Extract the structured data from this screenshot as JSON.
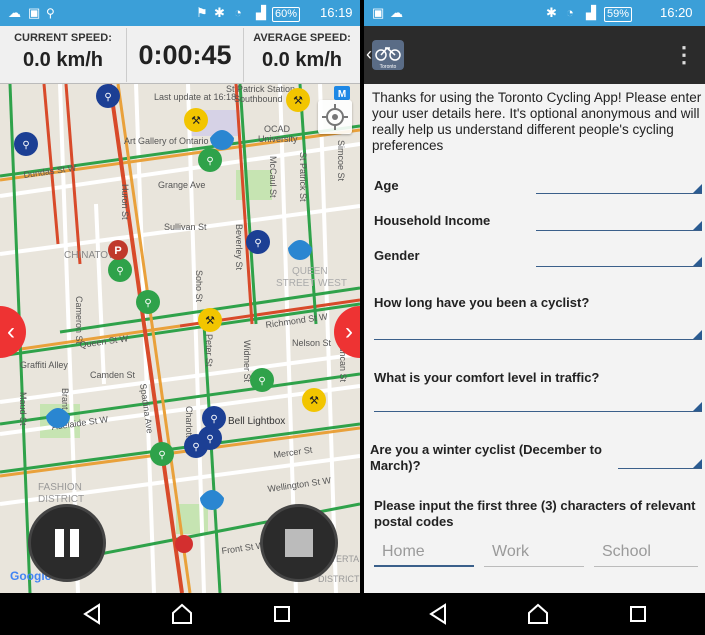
{
  "left_screen": {
    "status_bar": {
      "battery_text": "60%",
      "time": "16:19"
    },
    "speed_panel": {
      "current_speed_label": "CURRENT SPEED:",
      "current_speed_value": "0.0 km/h",
      "timer": "0:00:45",
      "average_speed_label": "AVERAGE SPEED:",
      "average_speed_value": "0.0 km/h"
    },
    "map": {
      "last_update": "Last update at 16:18",
      "labels": [
        "St Patrick Station -",
        "Southbound",
        "OCAD",
        "University",
        "Art Gallery of Ontario",
        "Dundas St W",
        "Huron St",
        "Grange Ave",
        "McCaul St",
        "St Patrick St",
        "Simcoe St",
        "Sullivan St",
        "Beverley St",
        "CHINATOWN",
        "Soho St",
        "QUEEN",
        "STREET WEST",
        "Cameron St",
        "Queen St W",
        "Richmond St W",
        "Graffiti Alley",
        "Peter St",
        "Widmer St",
        "Nelson St",
        "Duncan St",
        "Maud St",
        "Brant St",
        "Camden St",
        "Spadina Ave",
        "Charlotte St",
        "Bell Lightbox",
        "Adelaide St W",
        "Mercer St",
        "Wellington St W",
        "FASHION",
        "DISTRICT",
        "Front St W",
        "ENTERTAINMENT",
        "DISTRICT",
        "Google"
      ],
      "icons": [
        "bike-share-icon",
        "construction-icon",
        "water-drop-icon",
        "bike-parking-icon",
        "locate-icon"
      ]
    },
    "controls": {
      "pause_icon": "pause-icon",
      "stop_icon": "stop-icon",
      "left_arrow": "‹",
      "right_arrow": "›"
    }
  },
  "right_screen": {
    "status_bar": {
      "battery_text": "59%",
      "time": "16:20"
    },
    "app_bar": {
      "logo_text": "Toronto",
      "menu_icon": "⋮"
    },
    "intro_lines": [
      "Thanks for using the Toronto Cycling App! Please enter",
      "your user details here. It's optional anonymous and will",
      "really help us understand different people's cycling",
      "preferences"
    ],
    "questions": {
      "age": "Age",
      "income": "Household Income",
      "gender": "Gender",
      "how_long": "How long have you been a cyclist?",
      "comfort": "What is your comfort level in traffic?",
      "winter_line1": "Are you a winter cyclist (December to",
      "winter_line2": "March)?",
      "postal_line1": "Please input the first three (3) characters of relevant",
      "postal_line2": "postal codes"
    },
    "postal_inputs": {
      "home_placeholder": "Home",
      "work_placeholder": "Work",
      "school_placeholder": "School"
    }
  },
  "colors": {
    "status_bar": "#3b9fd8",
    "app_bar": "#2b2b2b",
    "dropdown_accent": "#2a5b91",
    "bike_share_blue": "#1c3f94",
    "bike_parking_green": "#2fa24a",
    "construction_yellow": "#f2c500",
    "water_blue": "#2a86d1",
    "nav_arrow_red": "#e53935"
  }
}
